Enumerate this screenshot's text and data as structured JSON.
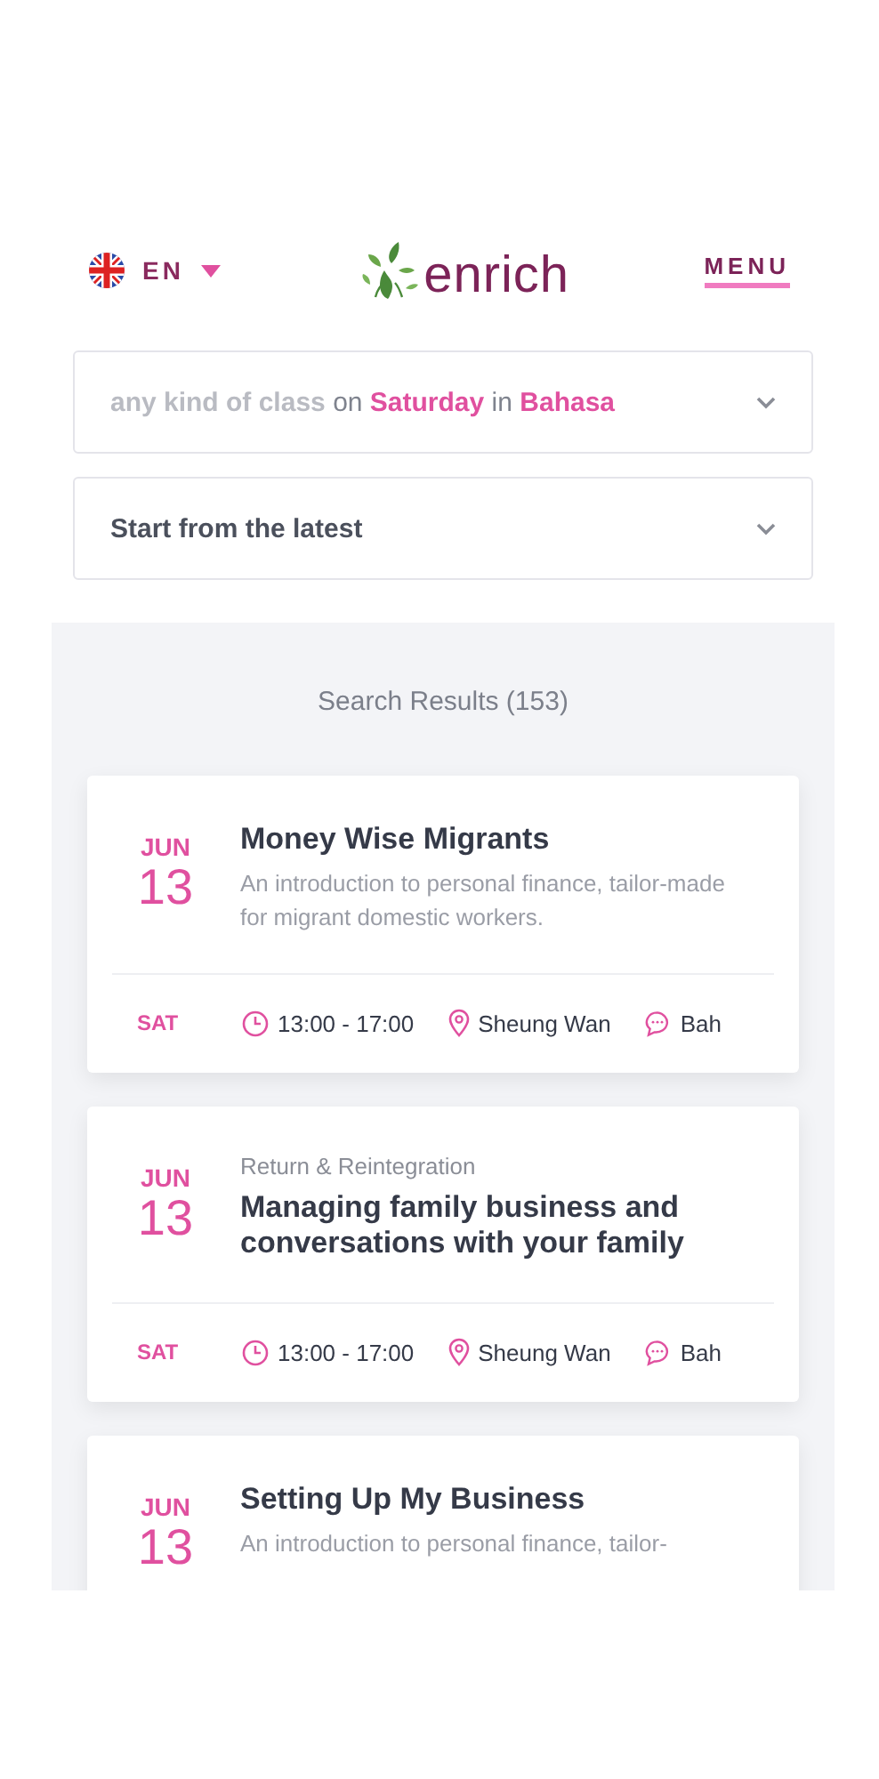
{
  "header": {
    "language": "EN",
    "logo": "enrich",
    "menu": "MENU"
  },
  "filters": [
    {
      "parts": [
        {
          "kind": "placeholder",
          "text": "any kind of class"
        },
        {
          "kind": "connector",
          "text": "on"
        },
        {
          "kind": "value",
          "text": "Saturday"
        },
        {
          "kind": "connector",
          "text": "in"
        },
        {
          "kind": "value",
          "text": "Bahasa"
        }
      ]
    },
    {
      "parts": [
        {
          "kind": "plain",
          "text": "Start from the latest"
        }
      ]
    }
  ],
  "results": {
    "title": "Search Results (153)",
    "events": [
      {
        "month": "JUN",
        "day": "13",
        "title": "Money Wise Migrants",
        "description": "An introduction to personal finance, tailor-made for migrant domestic workers.",
        "weekday": "SAT",
        "time": "13:00 - 17:00",
        "location": "Sheung Wan",
        "language": "Bah"
      },
      {
        "month": "JUN",
        "day": "13",
        "category": "Return & Reintegration",
        "title": "Managing family business and conversations with your family",
        "weekday": "SAT",
        "time": "13:00 - 17:00",
        "location": "Sheung Wan",
        "language": "Bah"
      },
      {
        "month": "JUN",
        "day": "13",
        "title": "Setting Up My Business",
        "description": "An introduction to personal finance, tailor-"
      }
    ]
  }
}
